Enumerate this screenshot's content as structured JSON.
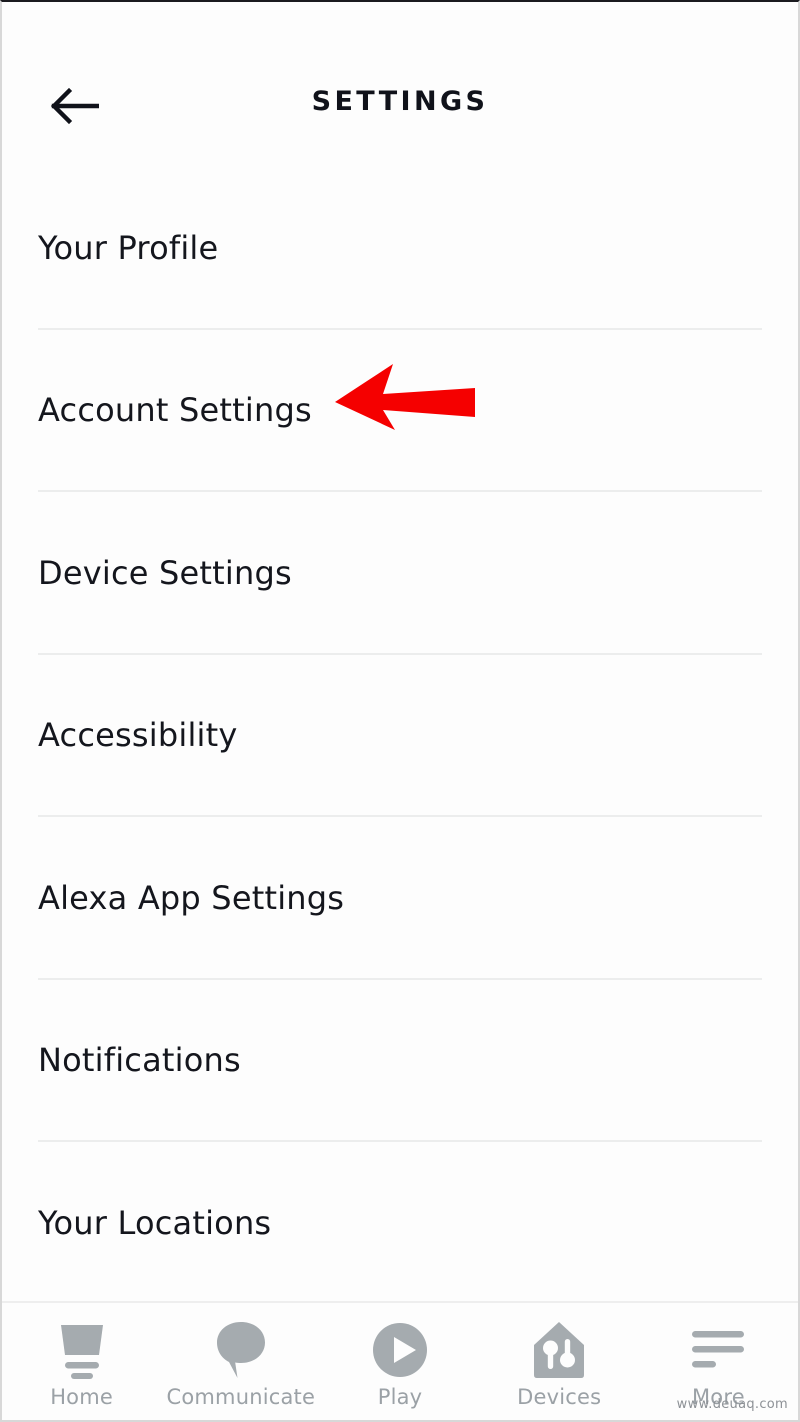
{
  "header": {
    "title": "SETTINGS",
    "back_icon": "arrow-left-icon"
  },
  "settings_list": {
    "items": [
      {
        "label": "Your Profile"
      },
      {
        "label": "Account Settings"
      },
      {
        "label": "Device Settings"
      },
      {
        "label": "Accessibility"
      },
      {
        "label": "Alexa App Settings"
      },
      {
        "label": "Notifications"
      },
      {
        "label": "Your Locations"
      }
    ]
  },
  "annotation": {
    "type": "arrow-left",
    "color": "#f50000",
    "points_at": "Account Settings"
  },
  "bottom_nav": {
    "items": [
      {
        "label": "Home",
        "icon": "echo-speaker-icon"
      },
      {
        "label": "Communicate",
        "icon": "speech-bubble-icon"
      },
      {
        "label": "Play",
        "icon": "play-circle-icon"
      },
      {
        "label": "Devices",
        "icon": "house-devices-icon"
      },
      {
        "label": "More",
        "icon": "hamburger-menu-icon"
      }
    ],
    "inactive_color": "#a5abaf",
    "label_color": "#9ba1a6"
  },
  "watermark": {
    "text": "www.deuaq.com"
  },
  "colors": {
    "background": "#fdfdfd",
    "text_primary": "#14161d",
    "divider": "#eceded",
    "accent_red": "#f50000"
  }
}
